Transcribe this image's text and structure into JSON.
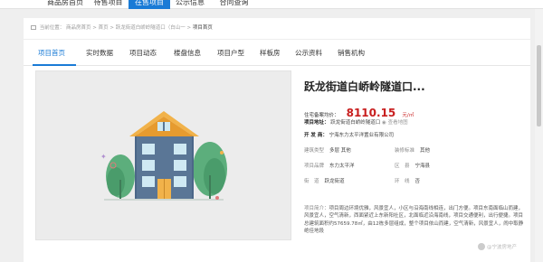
{
  "topnav": {
    "tabs": [
      {
        "label": "商品房首页"
      },
      {
        "label": "待售项目"
      },
      {
        "label": "在售项目"
      },
      {
        "label": "公示信息"
      },
      {
        "label": "合同查询"
      }
    ]
  },
  "breadcrumb": {
    "items": [
      "当前位置：",
      "商品房首页",
      "首页",
      "跃龙街道白峤岭隧道口（白山一",
      "项目首页"
    ],
    "separator": ">"
  },
  "tabs": [
    {
      "label": "项目首页"
    },
    {
      "label": "实时数据"
    },
    {
      "label": "项目动态"
    },
    {
      "label": "楼盘信息"
    },
    {
      "label": "项目户型"
    },
    {
      "label": "样板房"
    },
    {
      "label": "公示资料"
    },
    {
      "label": "销售机构"
    }
  ],
  "project": {
    "title": "跃龙街道白峤岭隧道口...",
    "price_label": "住宅备案均价：",
    "price_value": "8110.15",
    "price_unit": "元/㎡",
    "address_label": "项目地址：",
    "address_value": "跃龙街道白峤岭隧道口",
    "address_link": "查看地图",
    "developer_label": "开 发 商：",
    "developer_value": "宁海东力太平洋置业有限公司",
    "fields": [
      {
        "k": "建筑类型",
        "v": "多层 其他"
      },
      {
        "k": "装修标准",
        "v": "其他"
      },
      {
        "k": "项目品牌",
        "v": "东力太平洋"
      },
      {
        "k": "区　县",
        "v": "宁海县"
      },
      {
        "k": "街　道",
        "v": "跃龙街道"
      },
      {
        "k": "环　线",
        "v": "否"
      }
    ],
    "intro_label": "项目简介：",
    "intro_text": "项目周边环境优雅，风景宜人，小区与沿海南线相连，出门方便。项目东南面临山而建，风景宜人，空气清新，西面紧近上东新阳社区，北面临近沿海南线，项目交通便利，出行便捷。项目总建筑面积约57659.78㎡，由12栋多层组成，整个项目依山而建，空气清新，风景宜人，闹中取静绝佳地段"
  },
  "watermark": "@宁波房地产",
  "colors": {
    "accent": "#1a7bd6",
    "price": "#c81e1e"
  }
}
